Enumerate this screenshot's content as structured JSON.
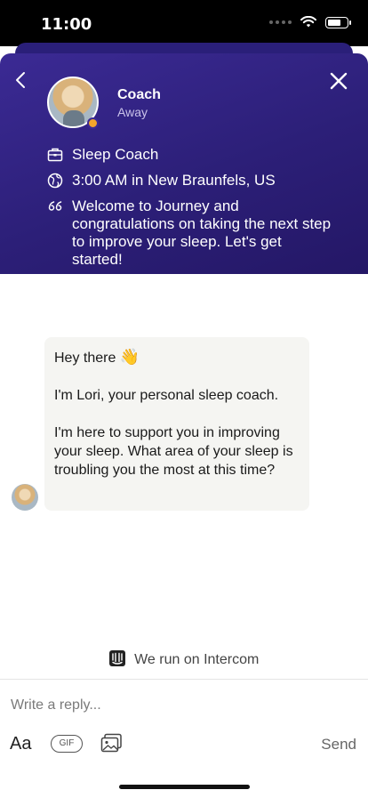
{
  "status_bar": {
    "time": "11:00"
  },
  "header": {
    "name": "Coach",
    "presence": "Away",
    "role": "Sleep Coach",
    "local_time": "3:00 AM in New Braunfels, US",
    "welcome": "Welcome to Journey and congratulations on taking the next step to improve your sleep. Let's get started!",
    "colors": {
      "background": "#2c1f78",
      "presence_dot": "#f4a52b"
    }
  },
  "message": {
    "greeting": "Hey there",
    "greeting_emoji": "👋",
    "intro": "I'm Lori, your personal sleep coach.",
    "question": "I'm here to support you in improving your sleep. What area of your sleep is troubling you the most at this time?"
  },
  "footer": {
    "powered_by": "We run on Intercom",
    "reply_placeholder": "Write a reply...",
    "format_label": "Aa",
    "gif_label": "GIF",
    "send_label": "Send"
  }
}
